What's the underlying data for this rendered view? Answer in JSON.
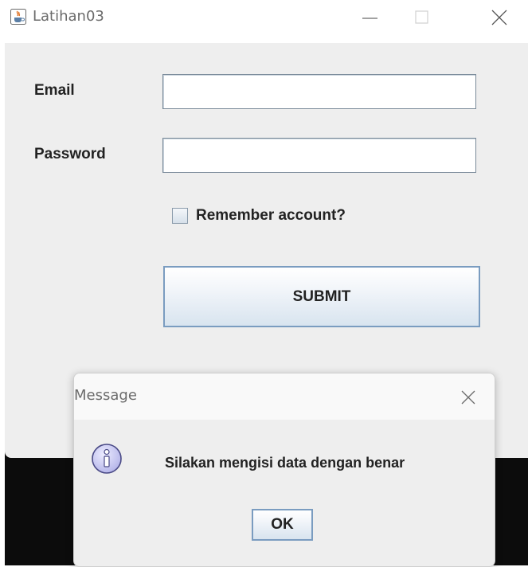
{
  "window": {
    "title": "Latihan03",
    "icon": "java-cup-icon"
  },
  "form": {
    "email_label": "Email",
    "email_value": "",
    "password_label": "Password",
    "password_value": "",
    "remember_label": "Remember account?",
    "remember_checked": false,
    "submit_label": "SUBMIT"
  },
  "dialog": {
    "title": "Message",
    "icon": "info-icon",
    "message": "Silakan mengisi data dengan benar",
    "ok_label": "OK"
  },
  "colors": {
    "panel_background": "#eeeeee",
    "button_border": "#7a9cc0",
    "info_icon_fill": "#c9c9f2"
  }
}
